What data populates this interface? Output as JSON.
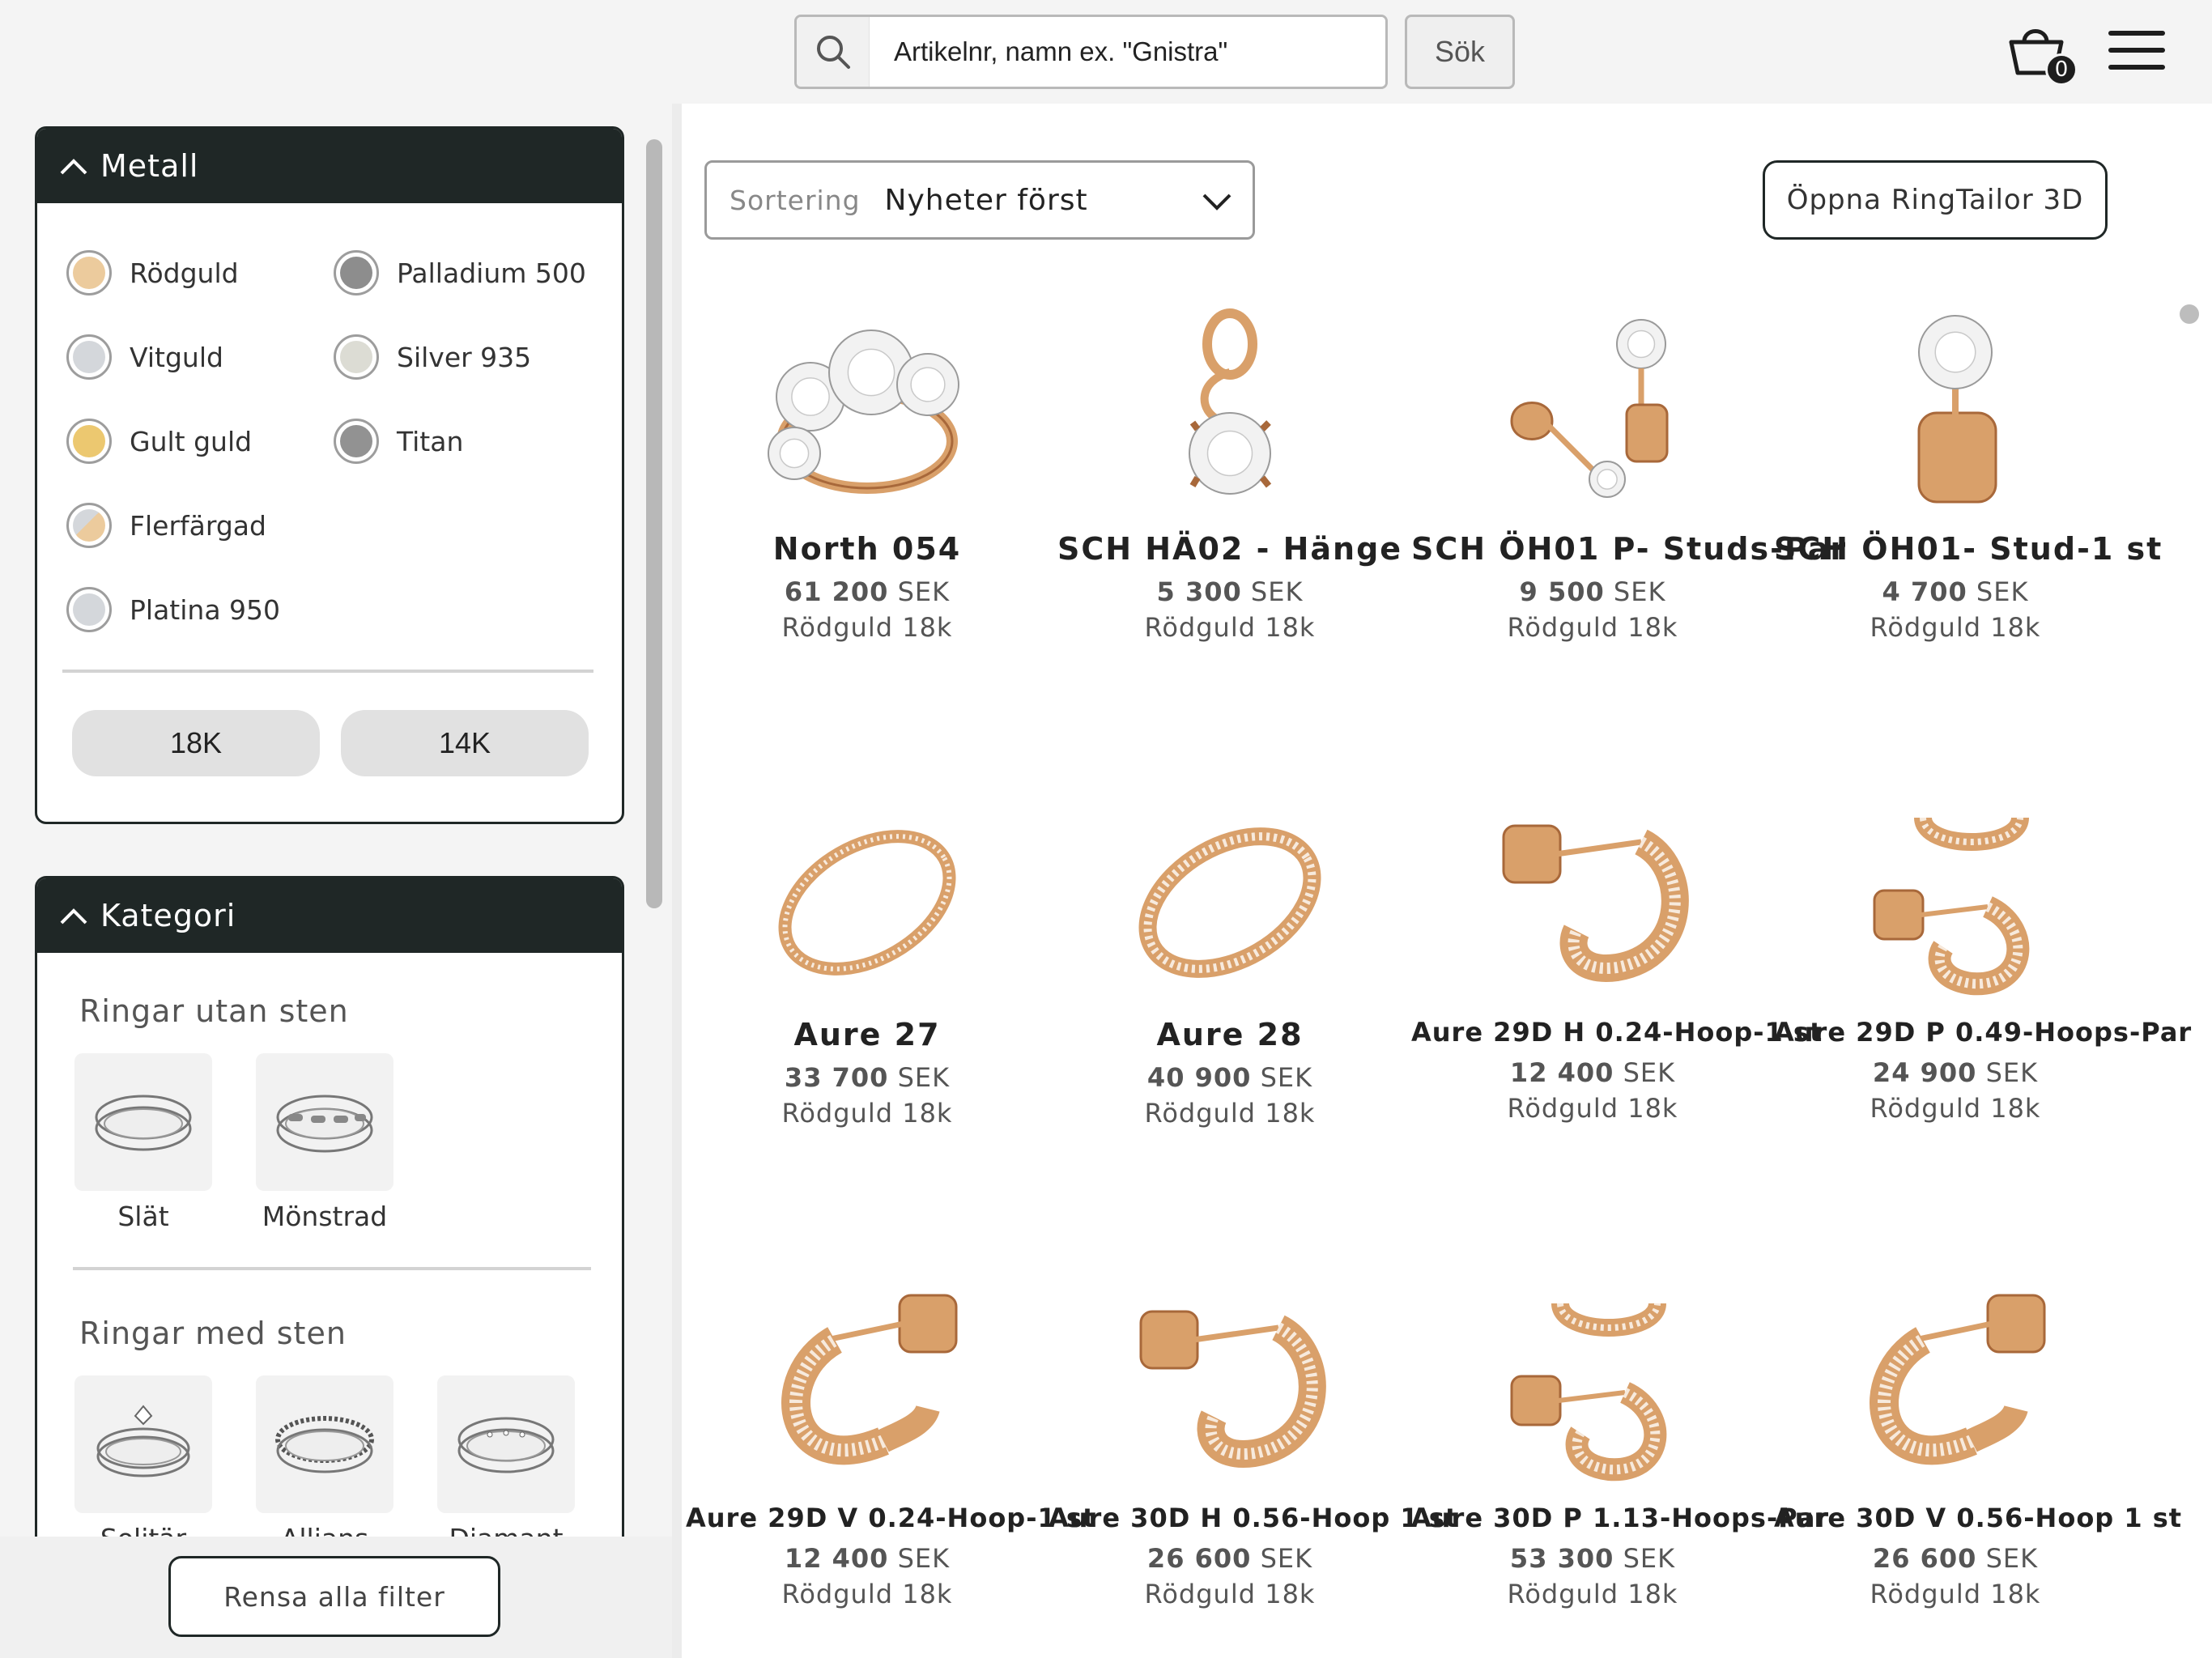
{
  "header": {
    "search_placeholder": "Artikelnr, namn ex. \"Gnistra\"",
    "search_button": "Sök",
    "cart_count": "0"
  },
  "sidebar": {
    "metal_panel": {
      "title": "Metall",
      "options": [
        {
          "label": "Rödguld",
          "color": "#eccb9d"
        },
        {
          "label": "Palladium 500",
          "color": "#8d8d8d"
        },
        {
          "label": "Vitguld",
          "color": "#d4d7db"
        },
        {
          "label": "Silver 935",
          "color": "#dcdcd4"
        },
        {
          "label": "Gult guld",
          "color": "#ecc870"
        },
        {
          "label": "Titan",
          "color": "#929292"
        },
        {
          "label": "Flerfärgad",
          "color": "#eccb9d"
        },
        {
          "label": "Platina 950",
          "color": "#d4d7db"
        }
      ],
      "karats": [
        "18K",
        "14K"
      ]
    },
    "category_panel": {
      "title": "Kategori",
      "group1_title": "Ringar utan sten",
      "group1_items": [
        "Slät",
        "Mönstrad"
      ],
      "group2_title": "Ringar med sten",
      "group2_items": [
        "Solitär",
        "Allians",
        "Diamant"
      ]
    },
    "clear_button": "Rensa alla filter"
  },
  "main": {
    "sort_label": "Sortering",
    "sort_value": "Nyheter först",
    "ringtailor_button": "Öppna RingTailor 3D",
    "products": [
      {
        "name": "North 054",
        "price_num": "61 200",
        "currency": "SEK",
        "metal": "Rödguld 18k",
        "type": "trilogy-ring"
      },
      {
        "name": "SCH HÄ02 - Hänge",
        "price_num": "5 300",
        "currency": "SEK",
        "metal": "Rödguld 18k",
        "type": "pendant"
      },
      {
        "name": "SCH ÖH01 P- Studs-Par",
        "price_num": "9 500",
        "currency": "SEK",
        "metal": "Rödguld 18k",
        "type": "stud-pair"
      },
      {
        "name": "SCH ÖH01- Stud-1 st",
        "price_num": "4 700",
        "currency": "SEK",
        "metal": "Rödguld 18k",
        "type": "stud-single"
      },
      {
        "name": "Aure 27",
        "price_num": "33 700",
        "currency": "SEK",
        "metal": "Rödguld 18k",
        "type": "pave-ring"
      },
      {
        "name": "Aure 28",
        "price_num": "40 900",
        "currency": "SEK",
        "metal": "Rödguld 18k",
        "type": "pave-ring-wide"
      },
      {
        "name": "Aure 29D H 0.24-Hoop-1 st",
        "price_num": "12 400",
        "currency": "SEK",
        "metal": "Rödguld 18k",
        "type": "hoop-side"
      },
      {
        "name": "Aure 29D P 0.49-Hoops-Par",
        "price_num": "24 900",
        "currency": "SEK",
        "metal": "Rödguld 18k",
        "type": "hoop-pair"
      },
      {
        "name": "Aure 29D V 0.24-Hoop-1 st",
        "price_num": "12 400",
        "currency": "SEK",
        "metal": "Rödguld 18k",
        "type": "hoop-front"
      },
      {
        "name": "Aure 30D H 0.56-Hoop 1 st",
        "price_num": "26 600",
        "currency": "SEK",
        "metal": "Rödguld 18k",
        "type": "hoop-side"
      },
      {
        "name": "Aure 30D P 1.13-Hoops-Par",
        "price_num": "53 300",
        "currency": "SEK",
        "metal": "Rödguld 18k",
        "type": "hoop-pair"
      },
      {
        "name": "Aure 30D V 0.56-Hoop 1 st",
        "price_num": "26 600",
        "currency": "SEK",
        "metal": "Rödguld 18k",
        "type": "hoop-front"
      }
    ]
  }
}
